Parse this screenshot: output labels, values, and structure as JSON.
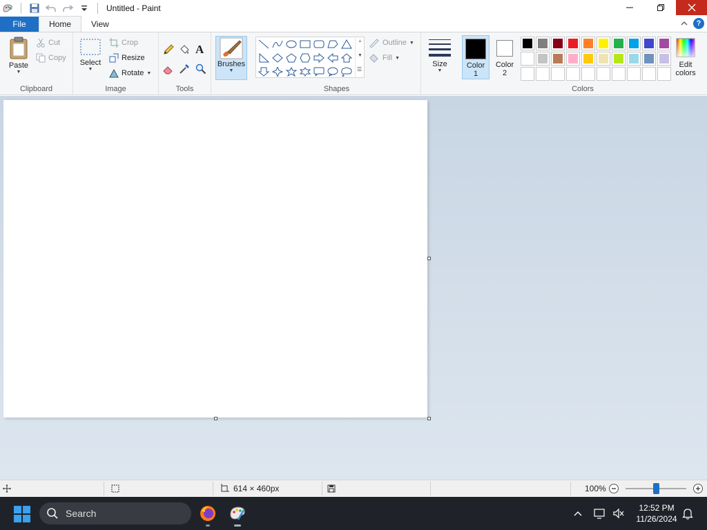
{
  "window": {
    "title": "Untitled - Paint"
  },
  "tabs": {
    "file": "File",
    "home": "Home",
    "view": "View"
  },
  "ribbon": {
    "clipboard": {
      "label": "Clipboard",
      "paste": "Paste",
      "cut": "Cut",
      "copy": "Copy"
    },
    "image": {
      "label": "Image",
      "select": "Select",
      "crop": "Crop",
      "resize": "Resize",
      "rotate": "Rotate"
    },
    "tools": {
      "label": "Tools"
    },
    "brushes": {
      "label": "Brushes"
    },
    "shapes": {
      "label": "Shapes",
      "outline": "Outline",
      "fill": "Fill"
    },
    "size": {
      "label": "Size"
    },
    "colors": {
      "label": "Colors",
      "color1_a": "Color",
      "color1_b": "1",
      "color2_a": "Color",
      "color2_b": "2",
      "edit_a": "Edit",
      "edit_b": "colors",
      "color1": "#000000",
      "color2": "#ffffff",
      "palette_row1": [
        "#000000",
        "#7f7f7f",
        "#880015",
        "#ed1c24",
        "#ff7f27",
        "#fff200",
        "#22b14c",
        "#00a2e8",
        "#3f48cc",
        "#a349a4"
      ],
      "palette_row2": [
        "#ffffff",
        "#c3c3c3",
        "#b97a57",
        "#ffaec9",
        "#ffc90e",
        "#efe4b0",
        "#b5e61d",
        "#99d9ea",
        "#7092be",
        "#c8bfe7"
      ],
      "palette_row3": [
        "#ffffff",
        "#ffffff",
        "#ffffff",
        "#ffffff",
        "#ffffff",
        "#ffffff",
        "#ffffff",
        "#ffffff",
        "#ffffff",
        "#ffffff"
      ]
    }
  },
  "status": {
    "dimensions": "614 × 460px",
    "zoom": "100%",
    "zoom_fraction": 0.5
  },
  "taskbar": {
    "search": "Search",
    "time": "12:52 PM",
    "date": "11/26/2024"
  }
}
